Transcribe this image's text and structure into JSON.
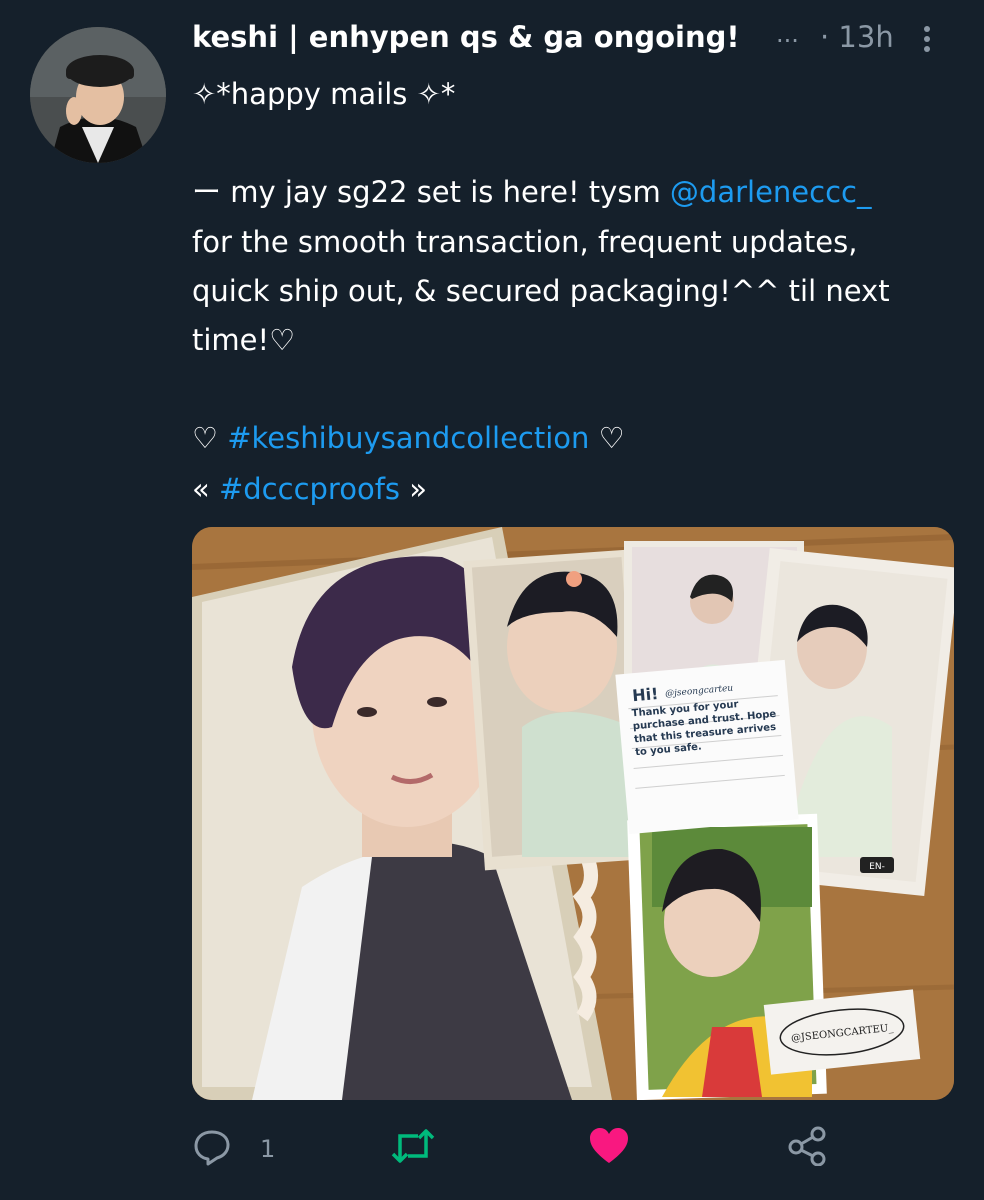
{
  "tweet": {
    "display_name": "keshi | enhypen qs & ga ongoing!",
    "truncation": "...",
    "time": "· 13h",
    "lines": [
      "✧*happy mails ✧*",
      "",
      "ー my jay sg22 set is here! tysm ",
      "for the smooth transaction, frequent updates,",
      "quick ship out, & secured packaging!^^ til next",
      "time!♡",
      "",
      "♡ ",
      "« "
    ],
    "mention": "@darleneccc_",
    "hashtag1_prefix": "♡ ",
    "hashtag1": "#keshibuysandcollection",
    "hashtag1_suffix": " ♡",
    "hashtag2_prefix": "« ",
    "hashtag2": "#dcccproofs",
    "hashtag2_suffix": " »"
  },
  "media": {
    "note": {
      "hi": "Hi!",
      "handle_small": "@jseongcarteu",
      "message": "Thank you for your purchase and trust. Hope that this treasure arrives to you safe."
    },
    "tag_label": "@JSEONGCARTEU_",
    "card_logo": "EN-"
  },
  "actions": {
    "reply_count": "1"
  },
  "colors": {
    "background": "#15202b",
    "link": "#1d9bf0",
    "muted": "#8b98a5",
    "retweet": "#00ba7c",
    "like": "#f91880"
  }
}
